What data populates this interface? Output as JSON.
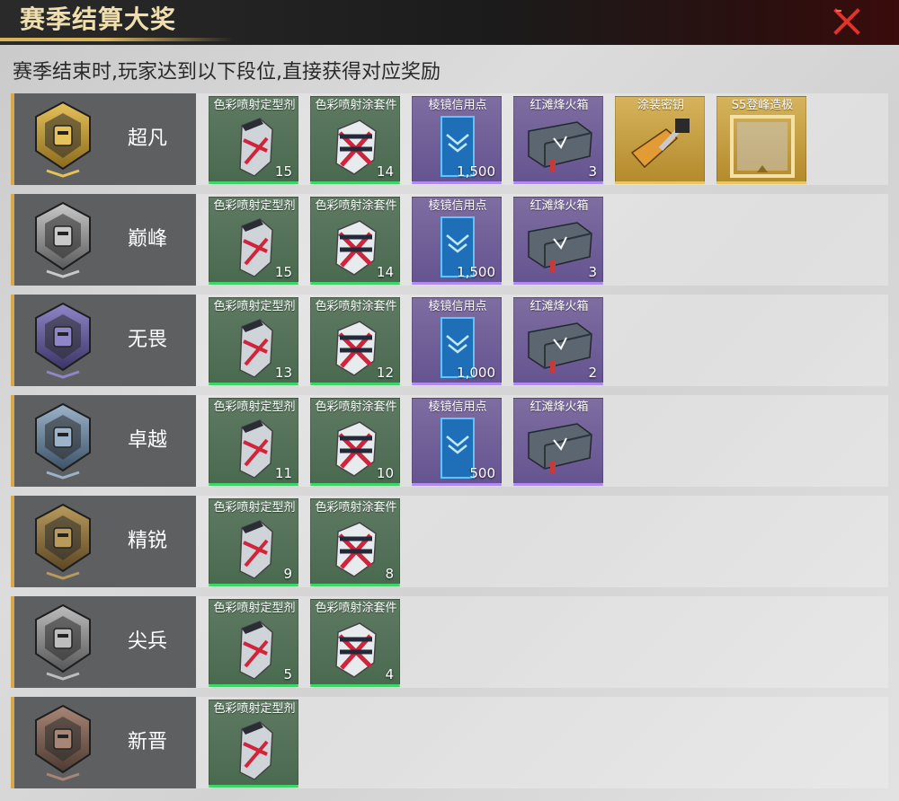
{
  "header": {
    "title": "赛季结算大奖"
  },
  "subtitle": "赛季结束时,玩家达到以下段位,直接获得对应奖励",
  "icons": {
    "close": "close-x-icon"
  },
  "colors": {
    "green_border": "#3fd36a",
    "purple_border": "#b08af2",
    "gold_bg": "#d6b35c",
    "rank_accent": "#d6a84a"
  },
  "tiers": [
    {
      "name": "超凡",
      "rewards": [
        {
          "label": "色彩喷射定型剂",
          "count": "15",
          "rarity": "green",
          "icon": "spray-can"
        },
        {
          "label": "色彩喷射涂套件",
          "count": "14",
          "rarity": "green",
          "icon": "spray-kit"
        },
        {
          "label": "棱镜信用点",
          "count": "1,500",
          "rarity": "purple",
          "icon": "prism-card"
        },
        {
          "label": "红滩烽火箱",
          "count": "3",
          "rarity": "purple",
          "icon": "crate"
        },
        {
          "label": "涂装密钥",
          "count": "",
          "rarity": "gold",
          "icon": "keys"
        },
        {
          "label": "S5登峰造极",
          "count": "",
          "rarity": "gold",
          "icon": "frame"
        }
      ]
    },
    {
      "name": "巅峰",
      "rewards": [
        {
          "label": "色彩喷射定型剂",
          "count": "15",
          "rarity": "green",
          "icon": "spray-can"
        },
        {
          "label": "色彩喷射涂套件",
          "count": "14",
          "rarity": "green",
          "icon": "spray-kit"
        },
        {
          "label": "棱镜信用点",
          "count": "1,500",
          "rarity": "purple",
          "icon": "prism-card"
        },
        {
          "label": "红滩烽火箱",
          "count": "3",
          "rarity": "purple",
          "icon": "crate"
        }
      ]
    },
    {
      "name": "无畏",
      "rewards": [
        {
          "label": "色彩喷射定型剂",
          "count": "13",
          "rarity": "green",
          "icon": "spray-can"
        },
        {
          "label": "色彩喷射涂套件",
          "count": "12",
          "rarity": "green",
          "icon": "spray-kit"
        },
        {
          "label": "棱镜信用点",
          "count": "1,000",
          "rarity": "purple",
          "icon": "prism-card"
        },
        {
          "label": "红滩烽火箱",
          "count": "2",
          "rarity": "purple",
          "icon": "crate"
        }
      ]
    },
    {
      "name": "卓越",
      "rewards": [
        {
          "label": "色彩喷射定型剂",
          "count": "11",
          "rarity": "green",
          "icon": "spray-can"
        },
        {
          "label": "色彩喷射涂套件",
          "count": "10",
          "rarity": "green",
          "icon": "spray-kit"
        },
        {
          "label": "棱镜信用点",
          "count": "500",
          "rarity": "purple",
          "icon": "prism-card"
        },
        {
          "label": "红滩烽火箱",
          "count": "",
          "rarity": "purple",
          "icon": "crate"
        }
      ]
    },
    {
      "name": "精锐",
      "rewards": [
        {
          "label": "色彩喷射定型剂",
          "count": "9",
          "rarity": "green",
          "icon": "spray-can"
        },
        {
          "label": "色彩喷射涂套件",
          "count": "8",
          "rarity": "green",
          "icon": "spray-kit"
        }
      ]
    },
    {
      "name": "尖兵",
      "rewards": [
        {
          "label": "色彩喷射定型剂",
          "count": "5",
          "rarity": "green",
          "icon": "spray-can"
        },
        {
          "label": "色彩喷射涂套件",
          "count": "4",
          "rarity": "green",
          "icon": "spray-kit"
        }
      ]
    },
    {
      "name": "新晋",
      "rewards": [
        {
          "label": "色彩喷射定型剂",
          "count": "",
          "rarity": "green",
          "icon": "spray-can"
        }
      ]
    }
  ]
}
